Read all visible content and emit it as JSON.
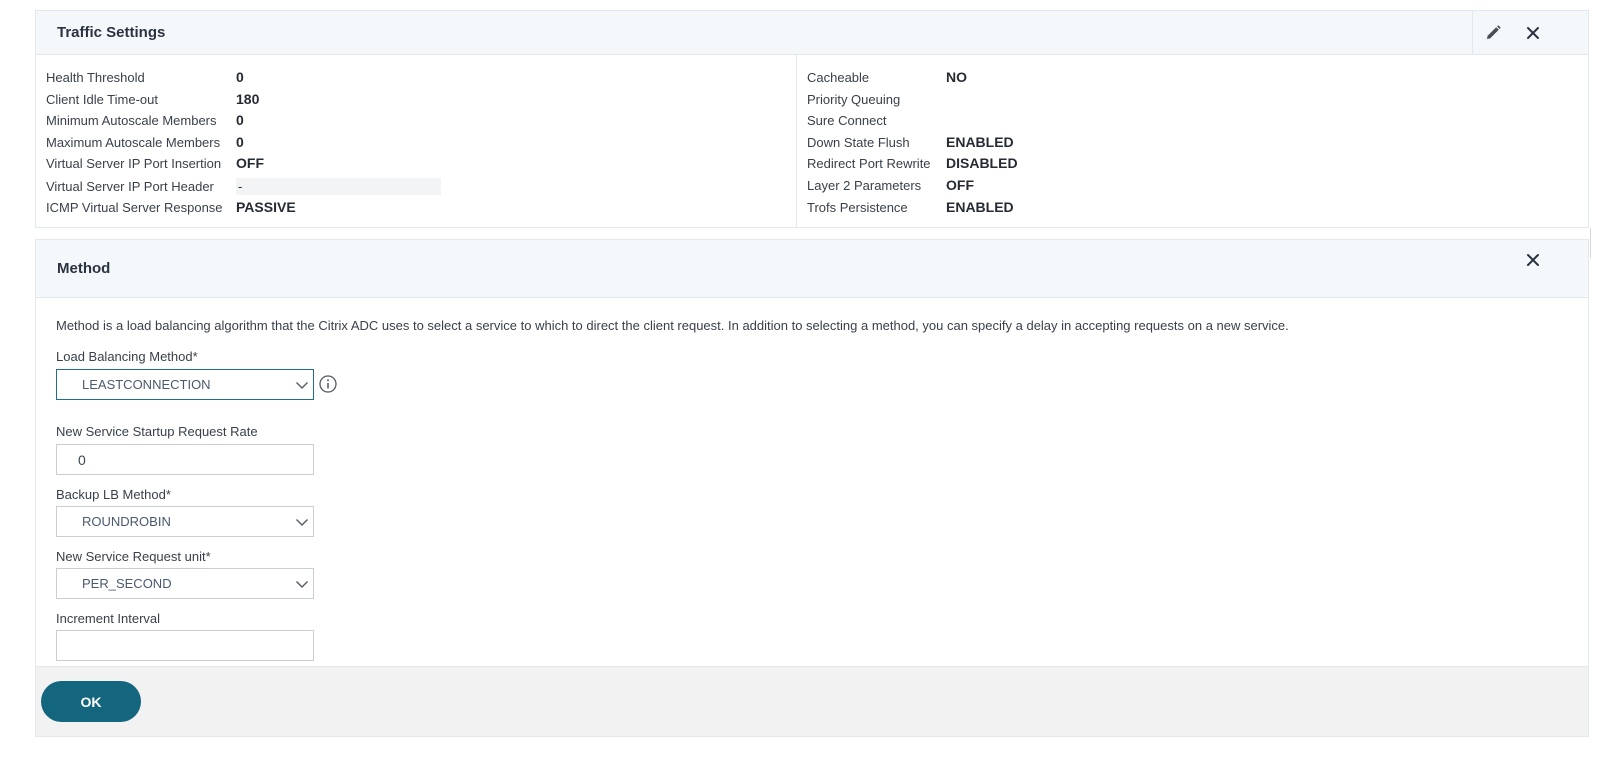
{
  "traffic": {
    "title": "Traffic Settings",
    "left": [
      {
        "label": "Health Threshold",
        "value": "0"
      },
      {
        "label": "Client Idle Time-out",
        "value": "180"
      },
      {
        "label": "Minimum Autoscale Members",
        "value": "0"
      },
      {
        "label": "Maximum Autoscale Members",
        "value": "0"
      },
      {
        "label": "Virtual Server IP Port Insertion",
        "value": "OFF"
      },
      {
        "label": "Virtual Server IP Port Header",
        "value": "-"
      },
      {
        "label": "ICMP Virtual Server Response",
        "value": "PASSIVE"
      }
    ],
    "right": [
      {
        "label": "Cacheable",
        "value": "NO"
      },
      {
        "label": "Priority Queuing",
        "value": ""
      },
      {
        "label": "Sure Connect",
        "value": ""
      },
      {
        "label": "Down State Flush",
        "value": "ENABLED"
      },
      {
        "label": "Redirect Port Rewrite",
        "value": "DISABLED"
      },
      {
        "label": "Layer 2 Parameters",
        "value": "OFF"
      },
      {
        "label": "Trofs Persistence",
        "value": "ENABLED"
      }
    ],
    "icons": {
      "edit": "pencil-icon",
      "close": "close-icon"
    }
  },
  "method": {
    "title": "Method",
    "description": "Method is a load balancing algorithm that the Citrix ADC uses to select a service to which to direct the client request. In addition to selecting a method, you can specify a delay in accepting requests on a new service.",
    "lb_method_label": "Load Balancing Method*",
    "lb_method_value": "LEASTCONNECTION",
    "startup_rate_label": "New Service Startup Request Rate",
    "startup_rate_value": "0",
    "backup_label": "Backup LB Method*",
    "backup_value": "ROUNDROBIN",
    "request_unit_label": "New Service Request unit*",
    "request_unit_value": "PER_SECOND",
    "increment_label": "Increment Interval",
    "increment_value": "",
    "ok_label": "OK"
  },
  "colors": {
    "accent": "#14657e",
    "header_bg": "#f5f8fb",
    "footer_bg": "#f2f2f2"
  }
}
